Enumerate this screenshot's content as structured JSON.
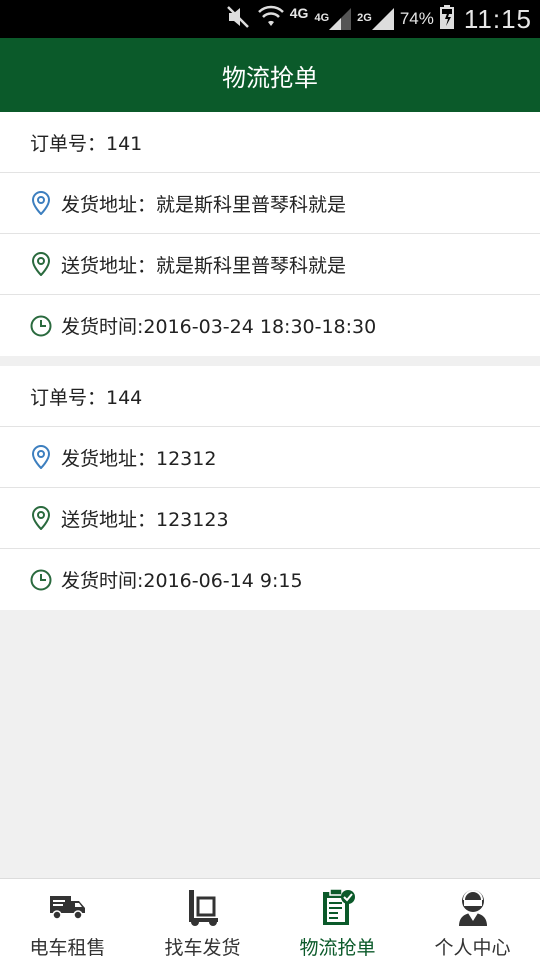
{
  "status_bar": {
    "network_primary": "4G",
    "network_small_1": "4G",
    "network_small_2": "2G",
    "battery": "74%",
    "time": "11:15"
  },
  "header": {
    "title": "物流抢单"
  },
  "orders": [
    {
      "order_no": "订单号：141",
      "ship_from": "发货地址：就是斯科里普琴科就是",
      "ship_to": "送货地址：就是斯科里普琴科就是",
      "ship_time": "发货时间:2016-03-24 18:30-18:30"
    },
    {
      "order_no": "订单号：144",
      "ship_from": "发货地址：12312",
      "ship_to": "送货地址：123123",
      "ship_time": "发货时间:2016-06-14 9:15"
    }
  ],
  "tabs": [
    {
      "label": "电车租售",
      "icon": "truck-icon"
    },
    {
      "label": "找车发货",
      "icon": "hand-truck-icon"
    },
    {
      "label": "物流抢单",
      "icon": "clipboard-check-icon",
      "active": true
    },
    {
      "label": "个人中心",
      "icon": "user-icon"
    }
  ],
  "colors": {
    "brand": "#0b5a2a",
    "pin_blue": "#3d7fbf",
    "pin_green": "#2a6a3e"
  }
}
